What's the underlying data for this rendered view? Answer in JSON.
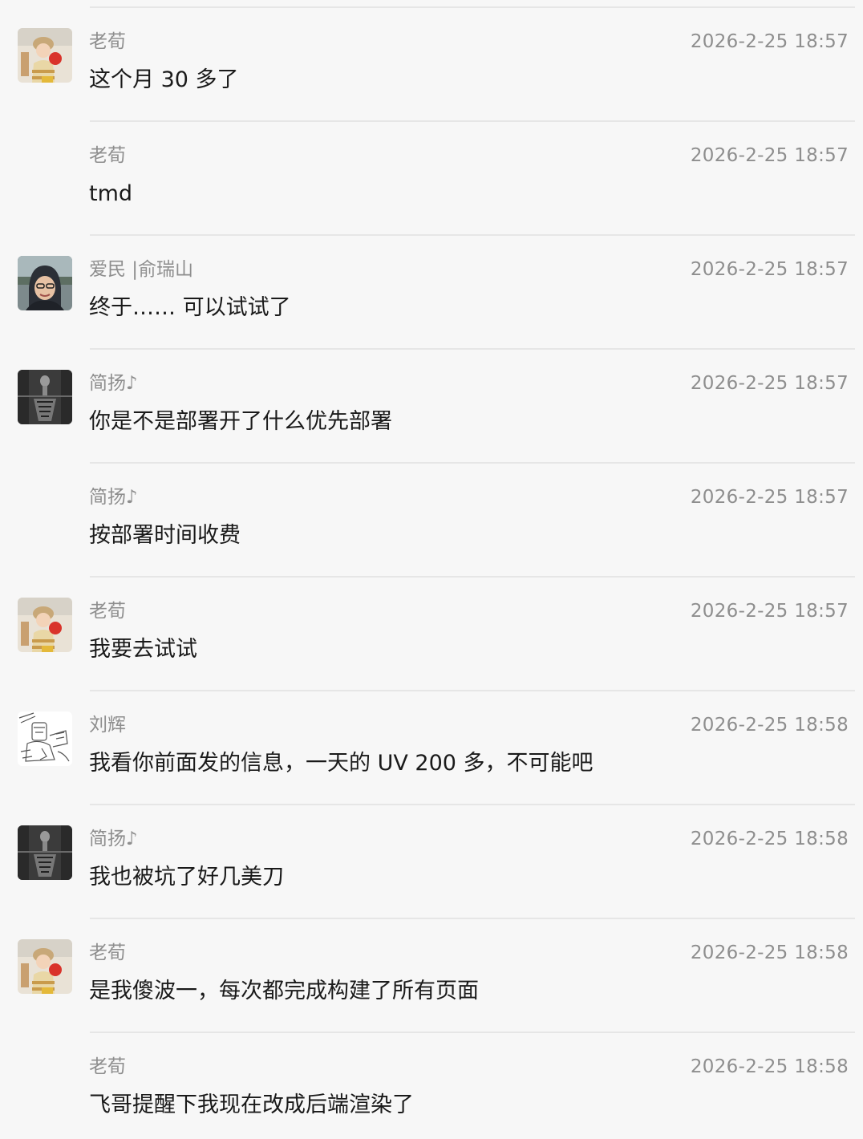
{
  "messages": [
    {
      "sender": "老荀",
      "time": "2026-2-25 18:57",
      "text": "这个月 30 多了",
      "avatar": "laoxun-avatar"
    },
    {
      "sender": "老荀",
      "time": "2026-2-25 18:57",
      "text": "tmd",
      "avatar": null
    },
    {
      "sender": "爱民 |俞瑞山",
      "time": "2026-2-25 18:57",
      "text": "终于…… 可以试试了",
      "avatar": "aimin-avatar"
    },
    {
      "sender": "简扬♪",
      "time": "2026-2-25 18:57",
      "text": "你是不是部署开了什么优先部署",
      "avatar": "jianyang-avatar"
    },
    {
      "sender": "简扬♪",
      "time": "2026-2-25 18:57",
      "text": "按部署时间收费",
      "avatar": null
    },
    {
      "sender": "老荀",
      "time": "2026-2-25 18:57",
      "text": "我要去试试",
      "avatar": "laoxun-avatar"
    },
    {
      "sender": "刘辉",
      "time": "2026-2-25 18:58",
      "text": "我看你前面发的信息，一天的 UV 200 多，不可能吧",
      "avatar": "liuhui-avatar"
    },
    {
      "sender": "简扬♪",
      "time": "2026-2-25 18:58",
      "text": "我也被坑了好几美刀",
      "avatar": "jianyang-avatar"
    },
    {
      "sender": "老荀",
      "time": "2026-2-25 18:58",
      "text": "是我傻波一，每次都完成构建了所有页面",
      "avatar": "laoxun-avatar"
    },
    {
      "sender": "老荀",
      "time": "2026-2-25 18:58",
      "text": "飞哥提醒下我现在改成后端渲染了",
      "avatar": null
    }
  ],
  "colors": {
    "background": "#f7f7f7",
    "divider": "#e6e6e6",
    "meta_text": "#8e8e8e",
    "message_text": "#1a1a1a"
  }
}
